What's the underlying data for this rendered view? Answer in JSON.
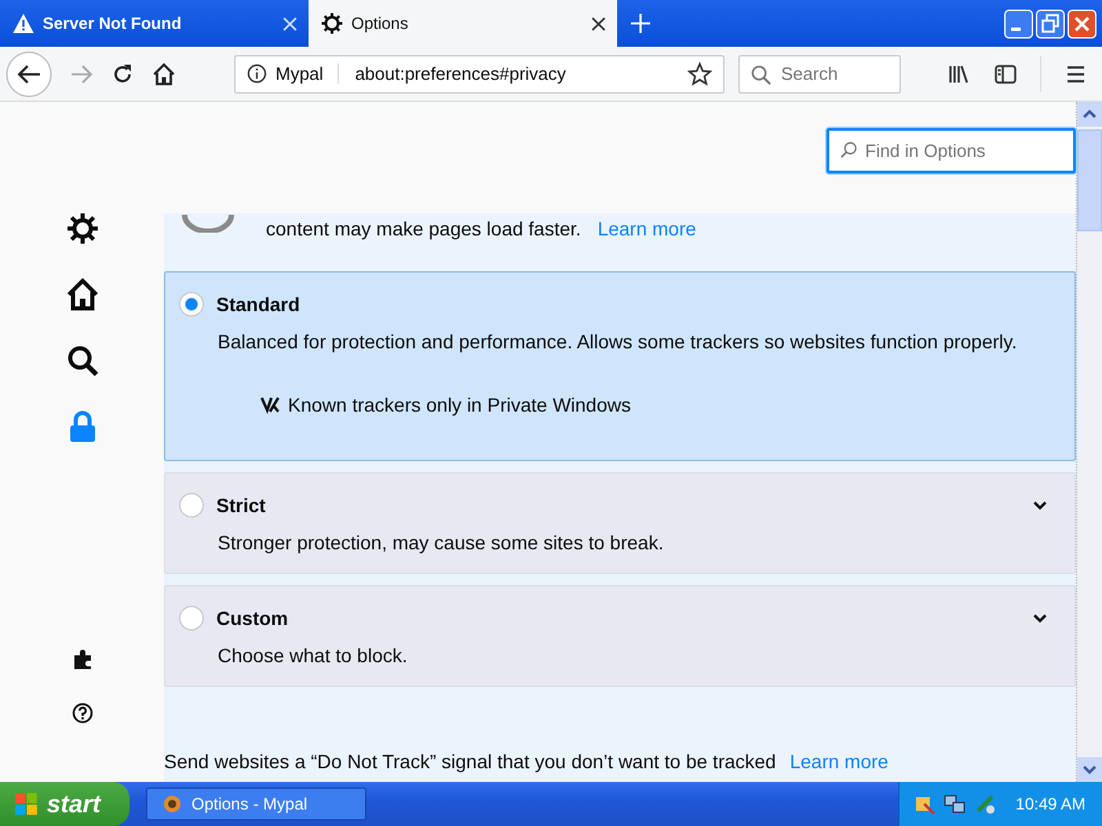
{
  "tabs": [
    {
      "title": "Server Not Found",
      "selected": false,
      "kind": "warning"
    },
    {
      "title": "Options",
      "selected": true,
      "kind": "gear"
    }
  ],
  "address_bar": {
    "identity": "Mypal",
    "url": "about:preferences#privacy"
  },
  "search": {
    "placeholder": "Search"
  },
  "find_field": {
    "placeholder": "Find in Options"
  },
  "sidebar": {
    "items": [
      {
        "kind": "gear",
        "selected": false
      },
      {
        "kind": "home",
        "selected": false
      },
      {
        "kind": "search",
        "selected": false
      },
      {
        "kind": "lock",
        "selected": true
      }
    ],
    "bottom_items": [
      {
        "kind": "puzzle"
      },
      {
        "kind": "help"
      }
    ]
  },
  "partial_card": {
    "text": "content may make pages load faster.",
    "link": "Learn more"
  },
  "options": [
    {
      "label": "Standard",
      "description": "Balanced for protection and performance. Allows some trackers so websites function properly.",
      "selected": true,
      "detail": "Known trackers only in Private Windows"
    },
    {
      "label": "Strict",
      "description": "Stronger protection, may cause some sites to break.",
      "selected": false
    },
    {
      "label": "Custom",
      "description": "Choose what to block.",
      "selected": false
    }
  ],
  "dnt": {
    "text": "Send websites a “Do Not Track” signal that you don’t want to be tracked",
    "link": "Learn more"
  },
  "taskbar": {
    "start": "start",
    "tasks": [
      {
        "title": "Options - Mypal",
        "selected": false
      }
    ],
    "clock": "10:49 AM"
  }
}
